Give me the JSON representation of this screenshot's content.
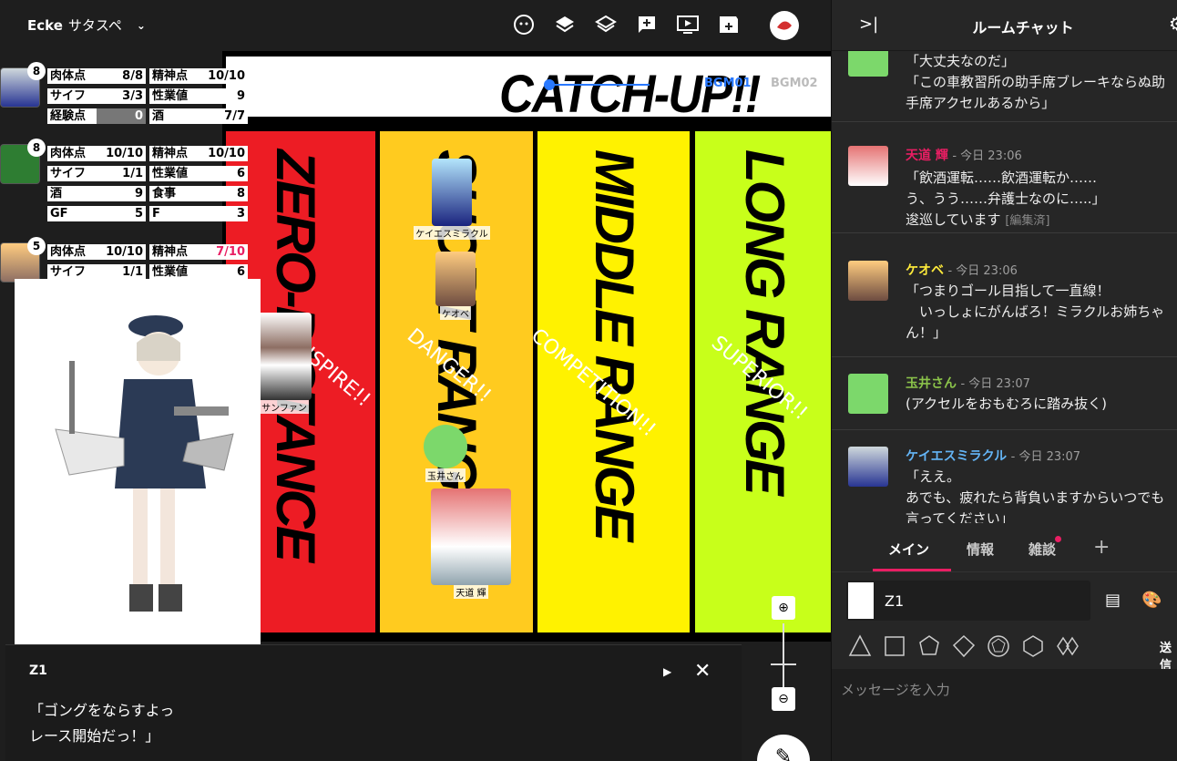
{
  "topbar": {
    "room_name": "Ecke",
    "room_subtitle": "サタスペ",
    "icons": [
      "face-icon",
      "layers-icon",
      "layers-outline-icon",
      "add-comment-icon",
      "play-screen-icon",
      "movie-add-icon",
      "avatar-icon"
    ]
  },
  "board": {
    "banner_title": "CATCH-UP!!",
    "bgm_tab_1": "BGM01",
    "bgm_tab_2": "BGM02",
    "lanes": [
      {
        "label": "ZERO-DISTANCE",
        "sub": "INSPIRE!!",
        "color": "#ed1c24"
      },
      {
        "label": "SHORT RANGE",
        "sub": "DANGER!!",
        "color": "#ffcb1f"
      },
      {
        "label": "MIDDLE RANGE",
        "sub": "COMPETITION!!",
        "color": "#fff200"
      },
      {
        "label": "LONG RANGE",
        "sub": "SUPERIOR!!",
        "color": "#c8ff1a"
      }
    ],
    "tokens": [
      {
        "name": "ケイエスミラクル"
      },
      {
        "name": "ケオベ"
      },
      {
        "name": "サンファン"
      },
      {
        "name": "玉井さん"
      },
      {
        "name": "天道 輝"
      }
    ]
  },
  "status": {
    "characters": [
      {
        "badge": "8",
        "rows": [
          [
            "肉体点",
            "8/8",
            "精神点",
            "10/10"
          ],
          [
            "サイフ",
            "3/3",
            "性業値",
            "9"
          ],
          [
            "経験点",
            "0",
            "酒",
            "7/7"
          ]
        ]
      },
      {
        "badge": "8",
        "rows": [
          [
            "肉体点",
            "10/10",
            "精神点",
            "10/10"
          ],
          [
            "サイフ",
            "1/1",
            "性業値",
            "6"
          ],
          [
            "酒",
            "9",
            "食事",
            "8"
          ],
          [
            "GF",
            "5",
            "F",
            "3"
          ]
        ]
      },
      {
        "badge": "5",
        "rows": [
          [
            "肉体点",
            "10/10",
            "精神点",
            "7/10"
          ],
          [
            "サイフ",
            "1/1",
            "性業値",
            "6"
          ]
        ]
      }
    ]
  },
  "message_window": {
    "speaker": "Z1",
    "text": "「ゴングをならすよっ\nレース開始だっ！」"
  },
  "chat": {
    "title": "ルームチャット",
    "messages": [
      {
        "name": "",
        "time": "",
        "color": "#fff",
        "body": "「大丈夫なのだ」\n「この車教習所の助手席ブレーキならぬ助\n手席アクセルあるから」",
        "edited": ""
      },
      {
        "name": "天道 輝",
        "time": "- 今日 23:06",
        "color": "#e91e63",
        "body": "「飲酒運転……飲酒運転か……\nう、うう……弁護士なのに…..」\n逡巡しています",
        "edited": "[編集済]"
      },
      {
        "name": "ケオベ",
        "time": "- 今日 23:06",
        "color": "#ffeb3b",
        "body": "「つまりゴール目指して一直線！\n　いっしょにがんばろ！ミラクルお姉ちゃ\nん！」",
        "edited": ""
      },
      {
        "name": "玉井さん",
        "time": "- 今日 23:07",
        "color": "#8bc34a",
        "body": "(アクセルをおもむろに踏み抜く)",
        "edited": ""
      },
      {
        "name": "ケイエスミラクル",
        "time": "- 今日 23:07",
        "color": "#64b5f6",
        "body": "「ええ。\nあでも、疲れたら背負いますからいつでも\n言ってください」",
        "edited": ""
      }
    ],
    "tabs": [
      "メイン",
      "情報",
      "雑談"
    ],
    "add_tab": "+",
    "character": "Z1",
    "send_label": "送信",
    "input_placeholder": "メッセージを入力"
  }
}
